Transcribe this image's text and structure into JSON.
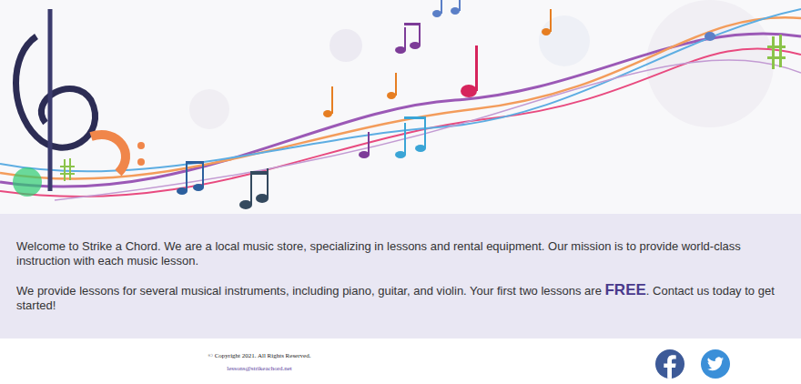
{
  "content": {
    "intro": "Welcome to Strike a Chord. We are a local music store, specializing in lessons and rental equipment. Our mission is to provide world-class instruction with each music lesson.",
    "offer_before": "We provide lessons for several musical instruments, including piano, guitar, and violin. Your first two lessons are ",
    "offer_emphasis": "FREE",
    "offer_after": ". Contact us today to get started!"
  },
  "footer": {
    "copyright": "© Copyright 2021. All Rights Reserved.",
    "email": "lessons@strikeachord.net"
  }
}
